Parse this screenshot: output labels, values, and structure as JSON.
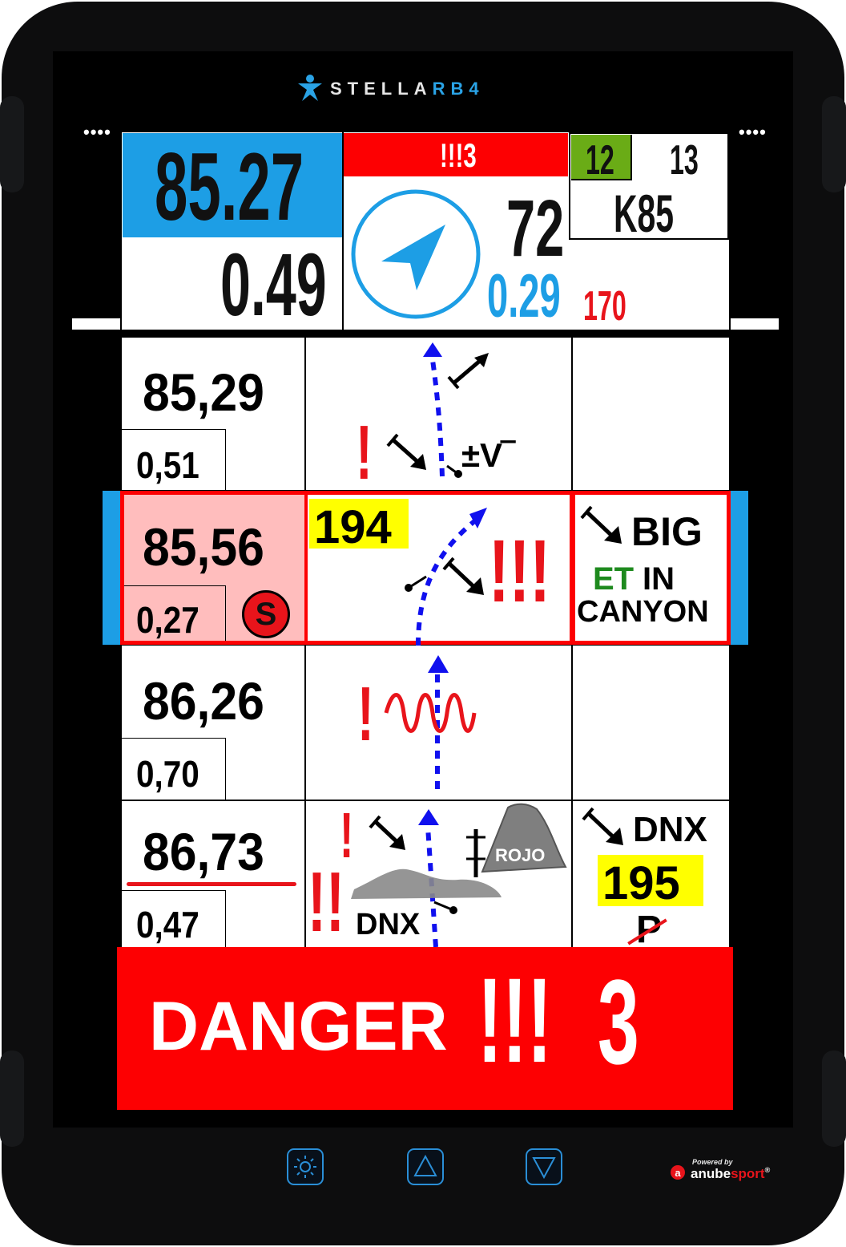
{
  "device": {
    "brand_prefix": "STELLA",
    "brand_suffix": "RB4",
    "menu_dots_left": "••••",
    "menu_dots_right": "••••",
    "powered_by": "Powered by",
    "anube": "anube",
    "sport": "sport",
    "registered": "®",
    "buttons": [
      "brightness-icon",
      "arrow-up-icon",
      "arrow-down-icon"
    ]
  },
  "header": {
    "total_distance": "85.27",
    "partial_distance": "0.49",
    "danger_banner_small": "!!!3",
    "heading_degrees": "72",
    "next_distance": "0.29",
    "next_heading": "170",
    "current_box": "12",
    "next_box": "13",
    "waypoint": "K85"
  },
  "roadbook": [
    {
      "distance": "85,29",
      "partial": "0,51",
      "notes": [
        "±V‾"
      ],
      "info": []
    },
    {
      "distance": "85,56",
      "partial": "0,27",
      "badge": "S",
      "cap": "194",
      "notes": [
        "!!!"
      ],
      "info": [
        "BIG",
        "ET",
        "IN",
        "CANYON"
      ],
      "active": true
    },
    {
      "distance": "86,26",
      "partial": "0,70",
      "notes": [
        "!"
      ],
      "info": []
    },
    {
      "distance": "86,73",
      "partial": "0,47",
      "notes": [
        "!",
        "!!",
        "DNX",
        "ROJO"
      ],
      "info": [
        "DNX",
        "195",
        "P"
      ]
    }
  ],
  "alert": {
    "label": "DANGER",
    "marks": "!!!",
    "level": "3"
  },
  "colors": {
    "accent_blue": "#1d9ee5",
    "danger_red": "#fd0002",
    "highlight_yellow": "#ffff00",
    "active_row_pink": "#ffbdbd",
    "green_box": "#6aac16"
  }
}
